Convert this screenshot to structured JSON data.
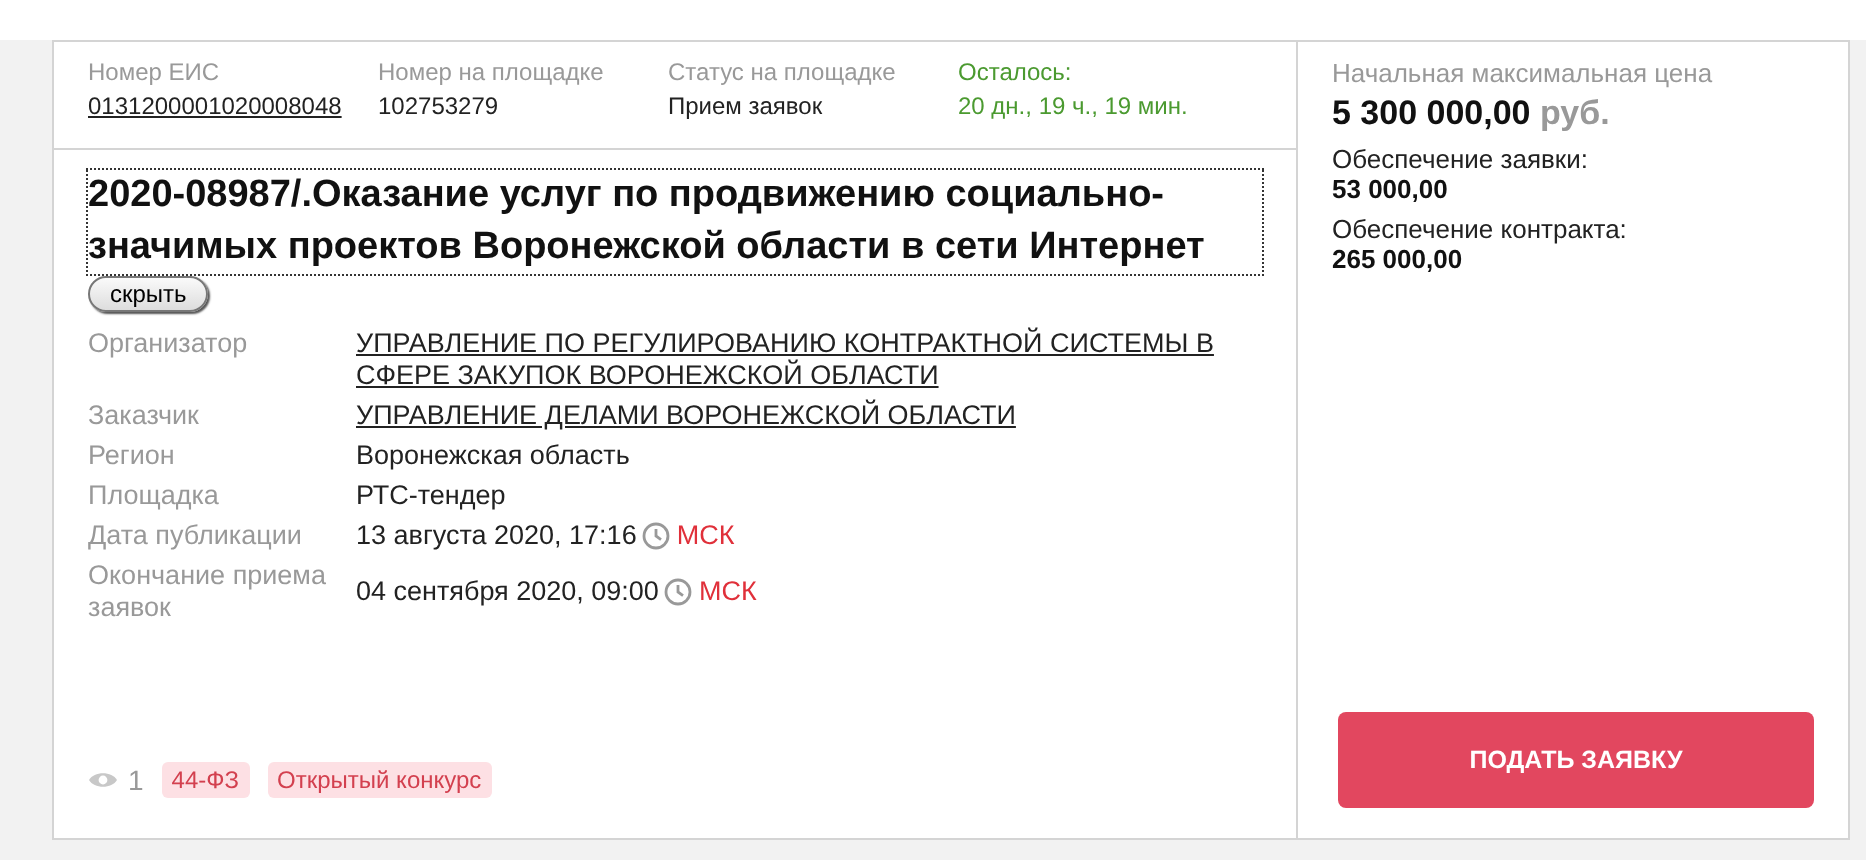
{
  "header": [
    {
      "label": "Номер ЕИС",
      "value": "0131200001020008048",
      "kind": "link"
    },
    {
      "label": "Номер на площадке",
      "value": "102753279",
      "kind": "text"
    },
    {
      "label": "Статус на площадке",
      "value": "Прием заявок",
      "kind": "text"
    },
    {
      "label": "Осталось:",
      "value": "20 дн., 19 ч., 19 мин.",
      "kind": "timer"
    }
  ],
  "title": "2020-08987/.Оказание услуг по продвижению социально-значимых проектов Воронежской области в сети Интернет",
  "hide_button": "скрыть",
  "details": [
    {
      "label": "Организатор",
      "value": "УПРАВЛЕНИЕ ПО РЕГУЛИРОВАНИЮ КОНТРАКТНОЙ СИСТЕМЫ В СФЕРЕ ЗАКУПОК ВОРОНЕЖСКОЙ ОБЛАСТИ",
      "kind": "link"
    },
    {
      "label": "Заказчик",
      "value": "УПРАВЛЕНИЕ ДЕЛАМИ ВОРОНЕЖСКОЙ ОБЛАСТИ",
      "kind": "link"
    },
    {
      "label": "Регион",
      "value": "Воронежская область",
      "kind": "text"
    },
    {
      "label": "Площадка",
      "value": "РТС-тендер",
      "kind": "text"
    },
    {
      "label": "Дата публикации",
      "value": "13 августа 2020, 17:16",
      "kind": "datetime",
      "timezone": "МСК"
    },
    {
      "label": "Окончание приема заявок",
      "value": "04 сентября 2020, 09:00",
      "kind": "datetime",
      "timezone": "МСК"
    }
  ],
  "views": "1",
  "tags": [
    "44-ФЗ",
    "Открытый конкурс"
  ],
  "price": {
    "label": "Начальная максимальная цена",
    "amount": "5 300 000,00",
    "currency": "руб."
  },
  "guarantees": [
    {
      "label": "Обеспечение заявки:",
      "value": "53 000,00"
    },
    {
      "label": "Обеспечение контракта:",
      "value": "265 000,00"
    }
  ],
  "apply_button": "ПОДАТЬ ЗАЯВКУ"
}
